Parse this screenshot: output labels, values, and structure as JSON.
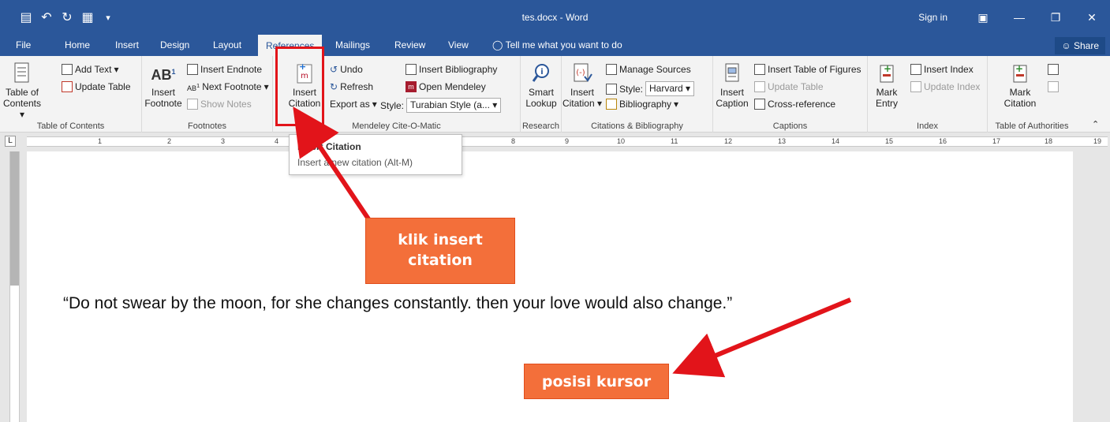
{
  "titlebar": {
    "doc_title": "tes.docx - Word",
    "sign_in": "Sign in"
  },
  "qat": [
    "save-icon",
    "undo-icon",
    "redo-icon",
    "touch-mode-icon",
    "customize-icon"
  ],
  "tabs": [
    {
      "label": "File"
    },
    {
      "label": "Home"
    },
    {
      "label": "Insert"
    },
    {
      "label": "Design"
    },
    {
      "label": "Layout"
    },
    {
      "label": "References",
      "active": true
    },
    {
      "label": "Mailings"
    },
    {
      "label": "Review"
    },
    {
      "label": "View"
    }
  ],
  "tell_me": "Tell me what you want to do",
  "share": "Share",
  "ribbon": {
    "toc": {
      "big_label1": "Table of",
      "big_label2": "Contents",
      "add_text": "Add Text",
      "update_table": "Update Table",
      "group": "Table of Contents"
    },
    "footnotes": {
      "ab": "AB",
      "insert_label1": "Insert",
      "insert_label2": "Footnote",
      "insert_endnote": "Insert Endnote",
      "next_footnote": "Next Footnote",
      "show_notes": "Show Notes",
      "group": "Footnotes"
    },
    "mendeley": {
      "insert_label1": "Insert",
      "insert_label2": "Citation",
      "undo": "Undo",
      "refresh": "Refresh",
      "export_as": "Export as",
      "insert_bibliography": "Insert Bibliography",
      "open_mendeley": "Open Mendeley",
      "style_label": "Style:",
      "style_value": "Turabian Style (a...",
      "group": "Mendeley Cite-O-Matic"
    },
    "research": {
      "smart_label1": "Smart",
      "smart_label2": "Lookup",
      "group": "Research"
    },
    "citations": {
      "insert_label1": "Insert",
      "insert_label2": "Citation",
      "manage_sources": "Manage Sources",
      "style_label": "Style:",
      "style_value": "Harvard",
      "bibliography": "Bibliography",
      "group": "Citations & Bibliography"
    },
    "captions": {
      "insert_label1": "Insert",
      "insert_label2": "Caption",
      "insert_tof": "Insert Table of Figures",
      "update_table": "Update Table",
      "cross_ref": "Cross-reference",
      "group": "Captions"
    },
    "index": {
      "mark_label1": "Mark",
      "mark_label2": "Entry",
      "insert_index": "Insert Index",
      "update_index": "Update Index",
      "group": "Index"
    },
    "toa": {
      "mark_label1": "Mark",
      "mark_label2": "Citation",
      "group": "Table of Authorities"
    }
  },
  "ruler": {
    "numbers": [
      "1",
      "2",
      "3",
      "4",
      "8",
      "9",
      "10",
      "11",
      "12",
      "13",
      "14",
      "15",
      "16",
      "17",
      "18",
      "19"
    ],
    "tab_marker": "L"
  },
  "tooltip": {
    "title": "Insert Citation",
    "desc": "Insert a new citation (Alt-M)"
  },
  "document": {
    "quote": "“Do not swear by the moon, for she changes constantly. then your love would also change.”"
  },
  "annotations": {
    "callout1_line1": "klik insert",
    "callout1_line2": "citation",
    "callout2": "posisi kursor"
  },
  "colors": {
    "title_bar": "#2b579a",
    "ribbon": "#f3f3f3",
    "highlight": "#e2141a",
    "callout": "#f36f3a"
  }
}
